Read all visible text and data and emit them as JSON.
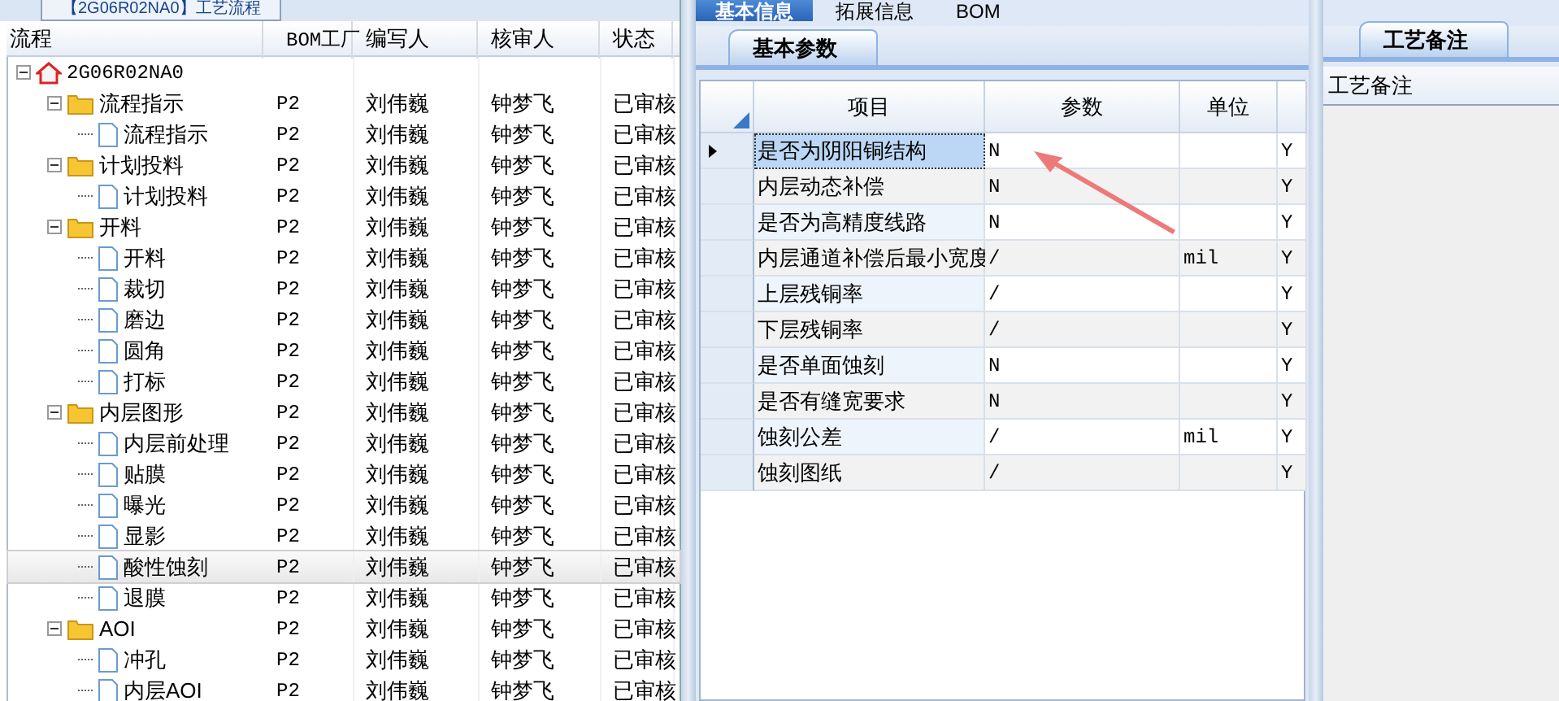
{
  "left_panel": {
    "tab": "【2G06R02NA0】工艺流程",
    "columns": [
      "流程",
      "BOM工厂",
      "编写人",
      "核审人",
      "状态"
    ],
    "tree": [
      {
        "label": "2G06R02NA0",
        "kind": "root",
        "expanded": true,
        "selected": false,
        "children": [
          {
            "label": "流程指示",
            "kind": "folder",
            "expanded": true,
            "selected": false,
            "factory": "P2",
            "writer": "刘伟巍",
            "reviewer": "钟梦飞",
            "status": "已审核",
            "children": [
              {
                "label": "流程指示",
                "kind": "file",
                "selected": false,
                "factory": "P2",
                "writer": "刘伟巍",
                "reviewer": "钟梦飞",
                "status": "已审核"
              }
            ]
          },
          {
            "label": "计划投料",
            "kind": "folder",
            "expanded": true,
            "selected": false,
            "factory": "P2",
            "writer": "刘伟巍",
            "reviewer": "钟梦飞",
            "status": "已审核",
            "children": [
              {
                "label": "计划投料",
                "kind": "file",
                "selected": false,
                "factory": "P2",
                "writer": "刘伟巍",
                "reviewer": "钟梦飞",
                "status": "已审核"
              }
            ]
          },
          {
            "label": "开料",
            "kind": "folder",
            "expanded": true,
            "selected": false,
            "factory": "P2",
            "writer": "刘伟巍",
            "reviewer": "钟梦飞",
            "status": "已审核",
            "children": [
              {
                "label": "开料",
                "kind": "file",
                "selected": false,
                "factory": "P2",
                "writer": "刘伟巍",
                "reviewer": "钟梦飞",
                "status": "已审核"
              },
              {
                "label": "裁切",
                "kind": "file",
                "selected": false,
                "factory": "P2",
                "writer": "刘伟巍",
                "reviewer": "钟梦飞",
                "status": "已审核"
              },
              {
                "label": "磨边",
                "kind": "file",
                "selected": false,
                "factory": "P2",
                "writer": "刘伟巍",
                "reviewer": "钟梦飞",
                "status": "已审核"
              },
              {
                "label": "圆角",
                "kind": "file",
                "selected": false,
                "factory": "P2",
                "writer": "刘伟巍",
                "reviewer": "钟梦飞",
                "status": "已审核"
              },
              {
                "label": "打标",
                "kind": "file",
                "selected": false,
                "factory": "P2",
                "writer": "刘伟巍",
                "reviewer": "钟梦飞",
                "status": "已审核"
              }
            ]
          },
          {
            "label": "内层图形",
            "kind": "folder",
            "expanded": true,
            "selected": false,
            "factory": "P2",
            "writer": "刘伟巍",
            "reviewer": "钟梦飞",
            "status": "已审核",
            "children": [
              {
                "label": "内层前处理",
                "kind": "file",
                "selected": false,
                "factory": "P2",
                "writer": "刘伟巍",
                "reviewer": "钟梦飞",
                "status": "已审核"
              },
              {
                "label": "贴膜",
                "kind": "file",
                "selected": false,
                "factory": "P2",
                "writer": "刘伟巍",
                "reviewer": "钟梦飞",
                "status": "已审核"
              },
              {
                "label": "曝光",
                "kind": "file",
                "selected": false,
                "factory": "P2",
                "writer": "刘伟巍",
                "reviewer": "钟梦飞",
                "status": "已审核"
              },
              {
                "label": "显影",
                "kind": "file",
                "selected": false,
                "factory": "P2",
                "writer": "刘伟巍",
                "reviewer": "钟梦飞",
                "status": "已审核"
              },
              {
                "label": "酸性蚀刻",
                "kind": "file",
                "selected": true,
                "factory": "P2",
                "writer": "刘伟巍",
                "reviewer": "钟梦飞",
                "status": "已审核"
              },
              {
                "label": "退膜",
                "kind": "file",
                "selected": false,
                "factory": "P2",
                "writer": "刘伟巍",
                "reviewer": "钟梦飞",
                "status": "已审核"
              }
            ]
          },
          {
            "label": "AOI",
            "kind": "folder",
            "expanded": true,
            "selected": false,
            "factory": "P2",
            "writer": "刘伟巍",
            "reviewer": "钟梦飞",
            "status": "已审核",
            "children": [
              {
                "label": "冲孔",
                "kind": "file",
                "selected": false,
                "factory": "P2",
                "writer": "刘伟巍",
                "reviewer": "钟梦飞",
                "status": "已审核"
              },
              {
                "label": "内层AOI",
                "kind": "file",
                "selected": false,
                "factory": "P2",
                "writer": "刘伟巍",
                "reviewer": "钟梦飞",
                "status": "已审核"
              }
            ]
          }
        ]
      }
    ]
  },
  "middle_panel": {
    "tabs": [
      {
        "label": "基本信息",
        "selected": true
      },
      {
        "label": "拓展信息",
        "selected": false
      },
      {
        "label": "BOM",
        "selected": false
      }
    ],
    "sub_tab": "基本参数",
    "columns": [
      "项目",
      "参数",
      "单位"
    ],
    "rows": [
      {
        "item": "是否为阴阳铜结构",
        "value": "N",
        "unit": "",
        "column_4": "Y",
        "selected": true
      },
      {
        "item": "内层动态补偿",
        "value": "N",
        "unit": "",
        "column_4": "Y",
        "selected": false
      },
      {
        "item": "是否为高精度线路",
        "value": "N",
        "unit": "",
        "column_4": "Y",
        "selected": false
      },
      {
        "item": "内层通道补偿后最小宽度",
        "value": "/",
        "unit": "mil",
        "column_4": "Y",
        "selected": false
      },
      {
        "item": "上层残铜率",
        "value": "/",
        "unit": "",
        "column_4": "Y",
        "selected": false
      },
      {
        "item": "下层残铜率",
        "value": "/",
        "unit": "",
        "column_4": "Y",
        "selected": false
      },
      {
        "item": "是否单面蚀刻",
        "value": "N",
        "unit": "",
        "column_4": "Y",
        "selected": false
      },
      {
        "item": "是否有缝宽要求",
        "value": "N",
        "unit": "",
        "column_4": "Y",
        "selected": false
      },
      {
        "item": "蚀刻公差",
        "value": "/",
        "unit": "mil",
        "column_4": "Y",
        "selected": false
      },
      {
        "item": "蚀刻图纸",
        "value": "/",
        "unit": "",
        "column_4": "Y",
        "selected": false
      }
    ]
  },
  "right_panel": {
    "tab": "工艺备注",
    "header": "工艺备注"
  }
}
